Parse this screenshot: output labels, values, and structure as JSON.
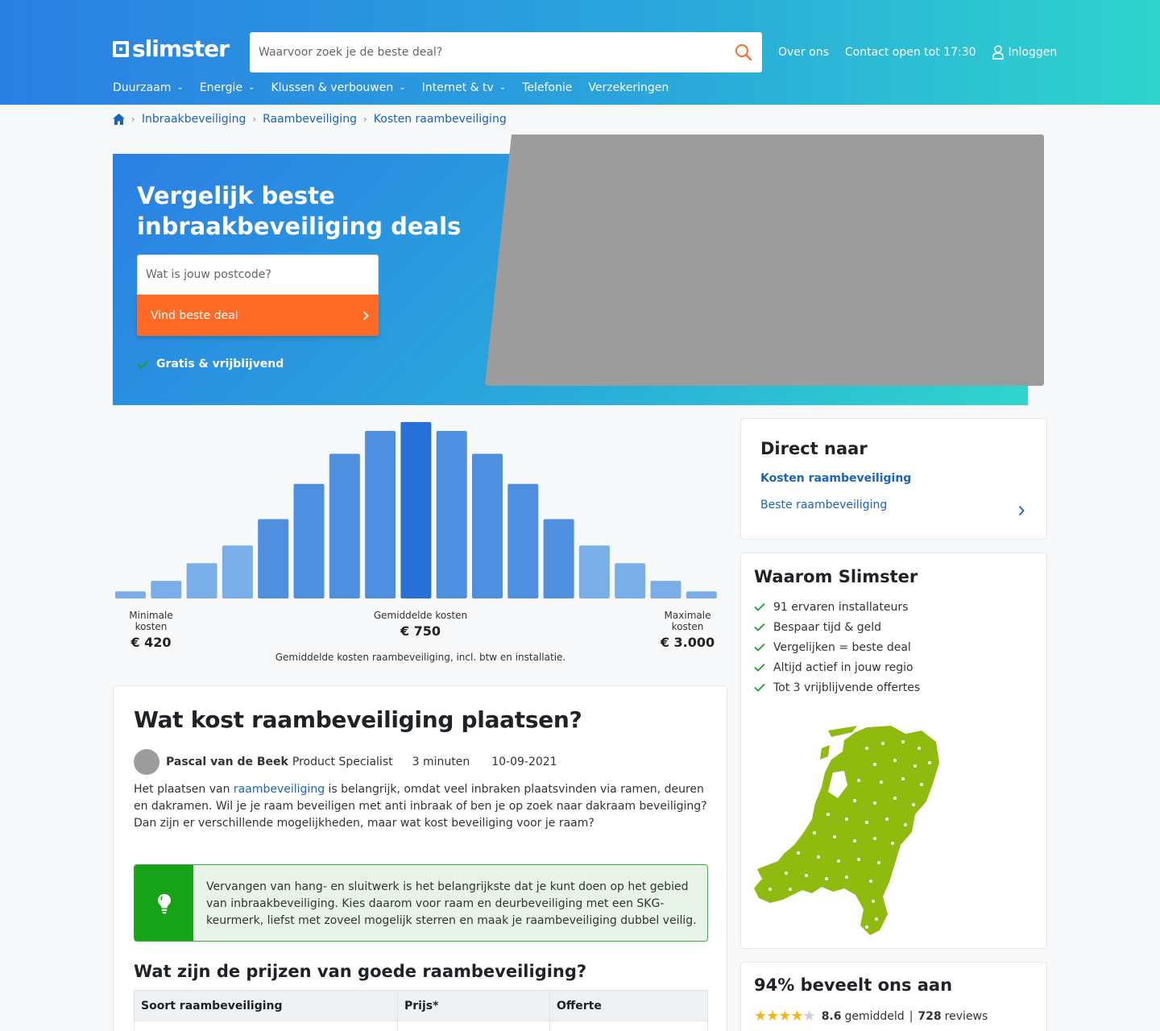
{
  "header": {
    "logo": "slimster",
    "search_placeholder": "Waarvoor zoek je de beste deal?",
    "about": "Over ons",
    "contact": "Contact open tot 17:30",
    "login": "Inloggen",
    "nav": [
      "Duurzaam",
      "Energie",
      "Klussen & verbouwen",
      "Internet & tv",
      "Telefonie",
      "Verzekeringen"
    ]
  },
  "breadcrumb": [
    "Inbraakbeveiliging",
    "Raambeveiliging",
    "Kosten raambeveiliging"
  ],
  "hero": {
    "title": "Vergelijk beste inbraakbeveiliging deals",
    "postcode_placeholder": "Wat is jouw postcode?",
    "cta": "Vind beste deal",
    "usp": "Gratis & vrijblijvend"
  },
  "chart_data": {
    "type": "bar",
    "values": [
      4,
      10,
      20,
      30,
      45,
      65,
      82,
      95,
      100,
      95,
      82,
      65,
      45,
      30,
      20,
      10,
      4
    ],
    "highlight_index": 8,
    "min_label": "Minimale kosten",
    "min_value": "€ 420",
    "avg_label": "Gemiddelde kosten",
    "avg_value": "€ 750",
    "max_label": "Maximale kosten",
    "max_value": "€ 3.000",
    "caption": "Gemiddelde kosten raambeveiliging, incl. btw en installatie.",
    "colors": {
      "base": "#4f8fe0",
      "light": "#7aaee9",
      "highlight": "#2670d8"
    }
  },
  "article": {
    "title": "Wat kost raambeveiliging plaatsen?",
    "author": "Pascal van de Beek",
    "role": "Product Specialist",
    "read_time": "3 minuten",
    "date": "10-09-2021",
    "intro_before": "Het plaatsen van ",
    "intro_link": "raambeveiliging",
    "intro_after": " is belangrijk, omdat veel inbraken plaatsvinden via ramen, deuren en dakramen. Wil je je raam beveiligen met anti inbraak of ben je op zoek naar dakraam beveiliging? Dan zijn er verschillende mogelijkheden, maar wat kost beveiliging voor je raam?",
    "tip": "Vervangen van hang- en sluitwerk is het belangrijkste dat je kunt doen op het gebied van inbraakbeveiliging. Kies daarom voor raam en deurbeveiliging met een SKG-keurmerk, liefst met zoveel mogelijk sterren en maak je raambeveiliging dubbel veilig.",
    "subtitle": "Wat zijn de prijzen van goede raambeveiliging?",
    "table_headers": [
      "Soort raambeveiliging",
      "Prijs*",
      "Offerte"
    ]
  },
  "sidebar": {
    "direct_title": "Direct naar",
    "direct_links": [
      "Kosten raambeveiliging",
      "Beste raambeveiliging"
    ],
    "why_title": "Waarom Slimster",
    "why_items": [
      "91 ervaren installateurs",
      "Bespaar tijd & geld",
      "Vergelijken = beste deal",
      "Altijd actief in jouw regio",
      "Tot 3 vrijblijvende offertes"
    ],
    "recommend_title": "94% beveelt ons aan",
    "rating": "8.6",
    "rating_label": "gemiddeld",
    "reviews": "728",
    "reviews_label": "reviews",
    "star_value": 4.3
  }
}
